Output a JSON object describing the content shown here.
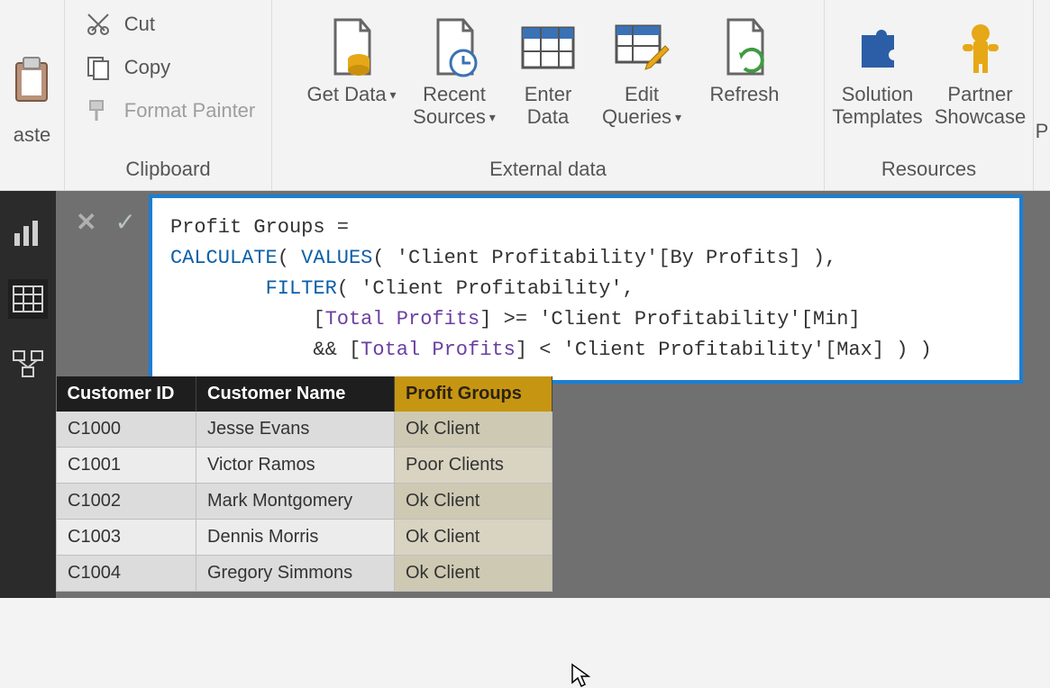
{
  "ribbon": {
    "paste": "aste",
    "clipboard": {
      "label": "Clipboard",
      "cut": "Cut",
      "copy": "Copy",
      "format_painter": "Format Painter"
    },
    "external": {
      "label": "External data",
      "get_data": "Get Data",
      "recent_sources": "Recent Sources",
      "enter_data": "Enter Data",
      "edit_queries": "Edit Queries",
      "refresh": "Refresh"
    },
    "resources": {
      "label": "Resources",
      "solution_templates": "Solution Templates",
      "partner_showcase": "Partner Showcase"
    }
  },
  "formula": {
    "l1_a": "Profit Groups = ",
    "l2_calc": "CALCULATE",
    "l2_paren": "( ",
    "l2_values": "VALUES",
    "l2_rest": "( 'Client Profitability'[By Profits] ),",
    "l3_pad": "        ",
    "l3_filter": "FILTER",
    "l3_rest": "( 'Client Profitability',",
    "l4_pad": "            [",
    "l4_tp": "Total Profits",
    "l4_rest": "] >= 'Client Profitability'[Min]",
    "l5_pad": "            && [",
    "l5_tp": "Total Profits",
    "l5_rest": "] < 'Client Profitability'[Max] ) )"
  },
  "table": {
    "headers": {
      "c1": "Customer ID",
      "c2": "Customer Name",
      "c3": "Profit Groups"
    },
    "rows": [
      {
        "id": "C1000",
        "name": "Jesse Evans",
        "group": "Ok Client"
      },
      {
        "id": "C1001",
        "name": "Victor Ramos",
        "group": "Poor Clients"
      },
      {
        "id": "C1002",
        "name": "Mark Montgomery",
        "group": "Ok Client"
      },
      {
        "id": "C1003",
        "name": "Dennis Morris",
        "group": "Ok Client"
      },
      {
        "id": "C1004",
        "name": "Gregory Simmons",
        "group": "Ok Client"
      }
    ]
  }
}
